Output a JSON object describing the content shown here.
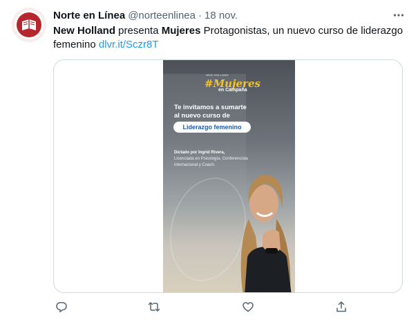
{
  "tweet": {
    "author_name": "Norte en Línea",
    "author_handle": "@norteenlinea",
    "separator": "·",
    "date": "18 nov.",
    "text": {
      "b1": "New Holland",
      "t1": " presenta ",
      "b2": "Mujeres",
      "t2": " Protagonistas, un nuevo curso de liderazgo femenino ",
      "link": "dlvr.it/Sczr8T"
    }
  },
  "poster": {
    "small_header": "NEW HOLLAND",
    "brand": "#Mujeres",
    "brand_sub": "en Campaña",
    "invite_line1": "Te invitamos a sumarte",
    "invite_line2": "al nuevo curso de",
    "pill": "Liderazgo femenino",
    "dictado_bold": "Dictado por Ingrid Rivera,",
    "dictado_rest": "Licenciada en Psicología, Conferencista internacional y Coach."
  },
  "icons": {
    "avatar": "book-logo-icon",
    "more": "more-horizontal-icon",
    "reply": "reply-icon",
    "retweet": "retweet-icon",
    "like": "heart-icon",
    "share": "share-icon"
  },
  "colors": {
    "link": "#1d9bf0",
    "secondary_text": "#536471",
    "brand_red": "#b5272d",
    "poster_gold": "#f2c230"
  }
}
